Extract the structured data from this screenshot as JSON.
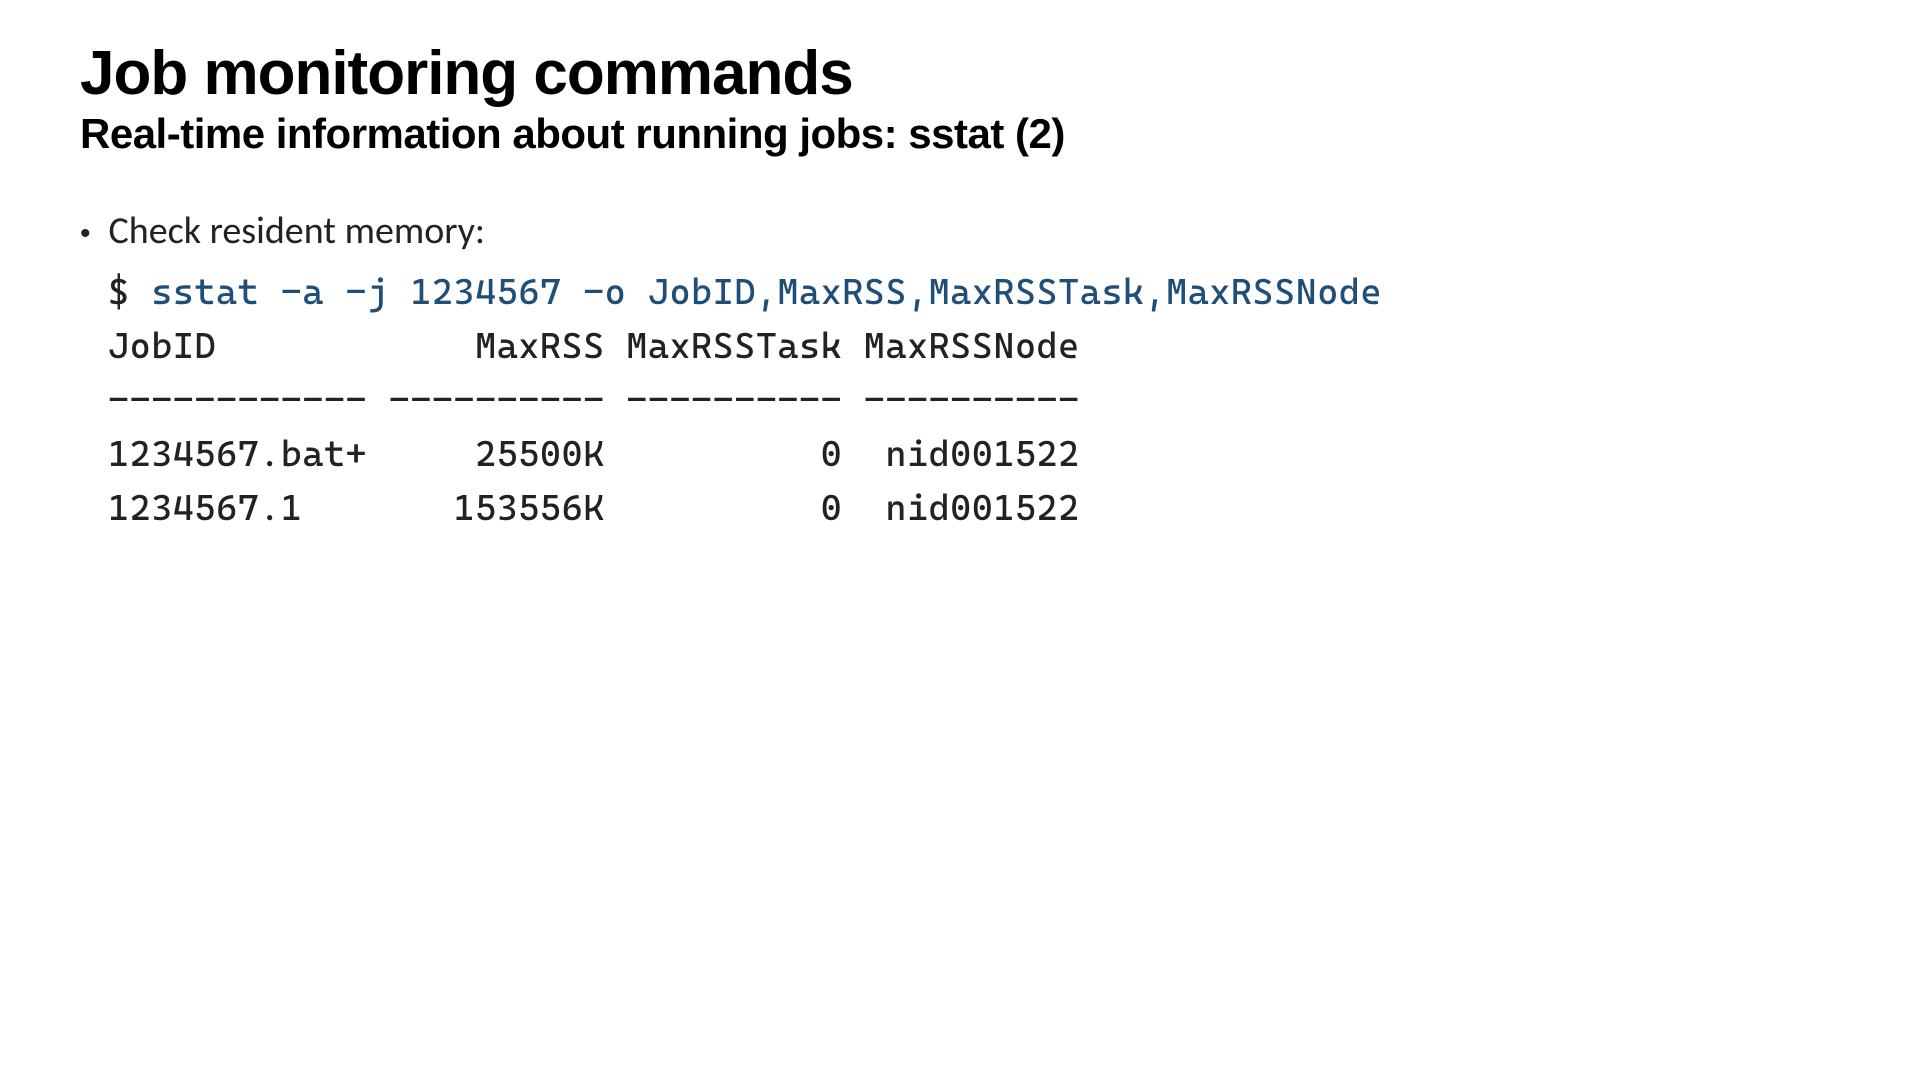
{
  "title": "Job monitoring commands",
  "subtitle": "Real-time information about running jobs: sstat (2)",
  "bullet": "Check resident memory:",
  "prompt": "$ ",
  "command": "sstat -a -j 1234567 -o JobID,MaxRSS,MaxRSSTask,MaxRSSNode",
  "output_header": "JobID            MaxRSS MaxRSSTask MaxRSSNode",
  "output_divider": "------------ ---------- ---------- ----------",
  "output_row1": "1234567.bat+     25500K          0  nid001522",
  "output_row2": "1234567.1       153556K          0  nid001522"
}
